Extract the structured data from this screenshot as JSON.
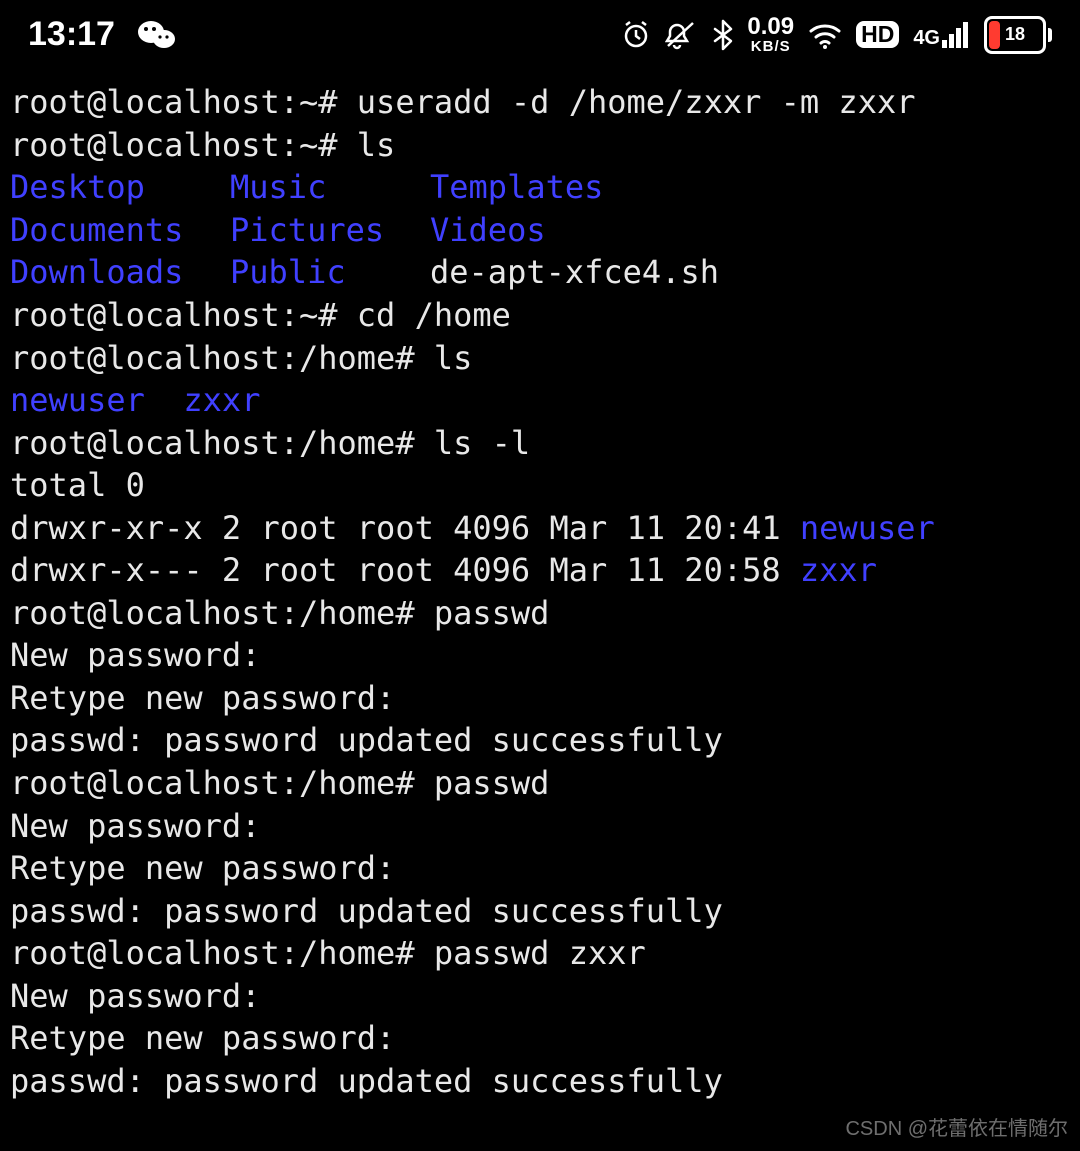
{
  "statusbar": {
    "time": "13:17",
    "netspeed_value": "0.09",
    "netspeed_unit": "KB/S",
    "hd_label": "HD",
    "net_gen": "4G",
    "battery_percent": "18"
  },
  "terminal": {
    "prompt_home": "root@localhost:~#",
    "prompt_home_dir": "root@localhost:/home#",
    "cmd1": "useradd -d /home/zxxr -m zxxr",
    "cmd2": "ls",
    "ls_dirs_row1": {
      "c1": "Desktop",
      "c2": "Music",
      "c3": "Templates"
    },
    "ls_dirs_row2": {
      "c1": "Documents",
      "c2": "Pictures",
      "c3": "Videos"
    },
    "ls_dirs_row3": {
      "c1": "Downloads",
      "c2": "Public",
      "c3_file": "de-apt-xfce4.sh"
    },
    "cmd3": "cd /home",
    "cmd4": "ls",
    "ls_home": {
      "a": "newuser",
      "b": "zxxr"
    },
    "cmd5": "ls -l",
    "total": "total 0",
    "ll1_meta": "drwxr-xr-x 2 root root 4096 Mar 11 20:41 ",
    "ll1_name": "newuser",
    "ll2_meta": "drwxr-x--- 2 root root 4096 Mar 11 20:58 ",
    "ll2_name": "zxxr",
    "cmd6": "passwd",
    "newpw": "New password:",
    "retypepw": "Retype new password:",
    "pwok": "passwd: password updated successfully",
    "cmd7": "passwd",
    "cmd8": "passwd zxxr"
  },
  "watermark": "CSDN @花蕾依在情随尔"
}
